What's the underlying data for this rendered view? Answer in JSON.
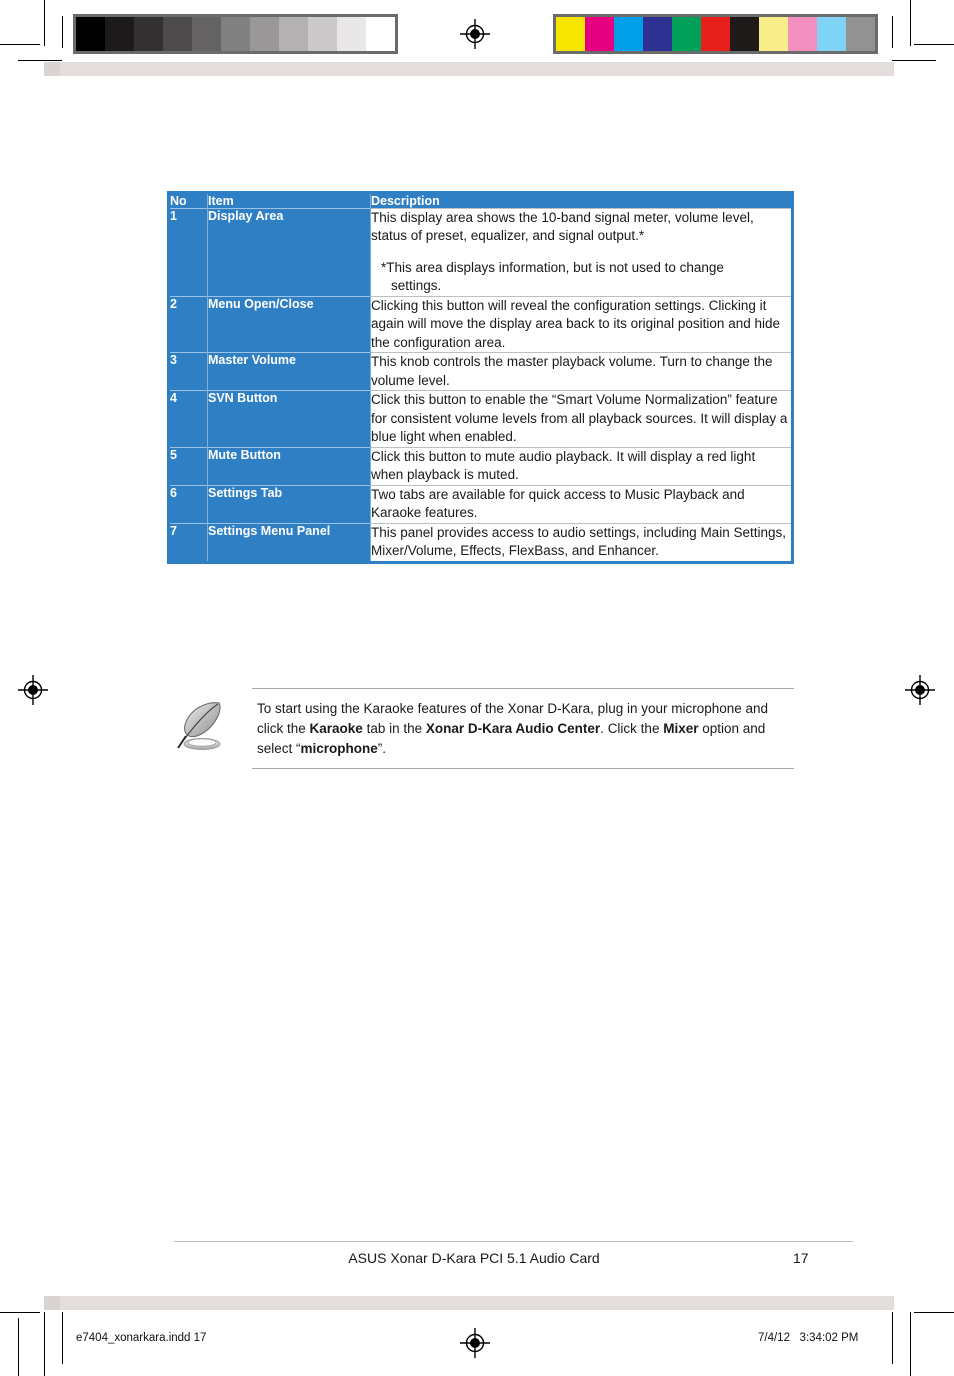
{
  "page": {
    "table": {
      "headers": [
        "No",
        "Item",
        "Description"
      ],
      "rows": [
        {
          "no": "1",
          "item": "Display Area",
          "desc": "This display area shows the 10-band signal meter, volume level, status of preset, equalizer, and signal output.*",
          "note": "*This area displays information, but is not used to change",
          "note_cont": "settings."
        },
        {
          "no": "2",
          "item": "Menu Open/Close",
          "desc": "Clicking this button will reveal the configuration settings. Clicking it again will move the display area back to its original position and hide the configuration area."
        },
        {
          "no": "3",
          "item": "Master Volume",
          "desc": "This knob controls the master playback volume. Turn to change the volume level."
        },
        {
          "no": "4",
          "item": "SVN Button",
          "desc": "Click this button to enable the “Smart Volume Normalization” feature for consistent volume levels from all playback sources. It will display a blue light when enabled."
        },
        {
          "no": "5",
          "item": "Mute Button",
          "desc": "Click this button to mute audio playback.  It will display a red light when playback is muted."
        },
        {
          "no": "6",
          "item": "Settings Tab",
          "desc": "Two tabs are available for quick access to Music Playback and Karaoke features."
        },
        {
          "no": "7",
          "item": "Settings Menu Panel",
          "desc": "This panel provides access to audio settings, including Main Settings, Mixer/Volume, Effects, FlexBass, and Enhancer."
        }
      ]
    },
    "note": {
      "icon": "quill-pen-icon",
      "line1_a": "To start using the Karaoke features of the Xonar D-Kara, plug in your",
      "line2_a": "microphone and click the ",
      "line2_b": "Karaoke",
      "line2_c": " tab in the ",
      "line2_d": "Xonar D-Kara Audio Center",
      "line2_e": ".",
      "line3_a": "Click the ",
      "line3_b": "Mixer",
      "line3_c": " option and select “",
      "line3_d": "microphone",
      "line3_e": "”."
    },
    "footer": {
      "title": "ASUS Xonar D-Kara PCI 5.1 Audio Card",
      "page_number": "17"
    },
    "slug": {
      "file": "e7404_xonarkara.indd   17",
      "date": "7/4/12   3:34:02 PM"
    }
  },
  "calibration": {
    "grayscale": [
      "#000000",
      "#1c1a1a",
      "#323030",
      "#4c4a4a",
      "#646262",
      "#808080",
      "#999797",
      "#b3b1b1",
      "#cbc9c9",
      "#e9e7e7",
      "#ffffff"
    ],
    "colors": [
      "#f5e500",
      "#e4007f",
      "#00a0e9",
      "#2e3192",
      "#00a05a",
      "#e8201c",
      "#1e1a1a",
      "#faee8a",
      "#f490c0",
      "#7fd4f5",
      "#929292"
    ],
    "border": "#6b6b6b"
  },
  "theme": {
    "table_blue": "#2f7fc4",
    "band_gray": "#e3dedb",
    "rule_gray": "#b9b9b9"
  }
}
